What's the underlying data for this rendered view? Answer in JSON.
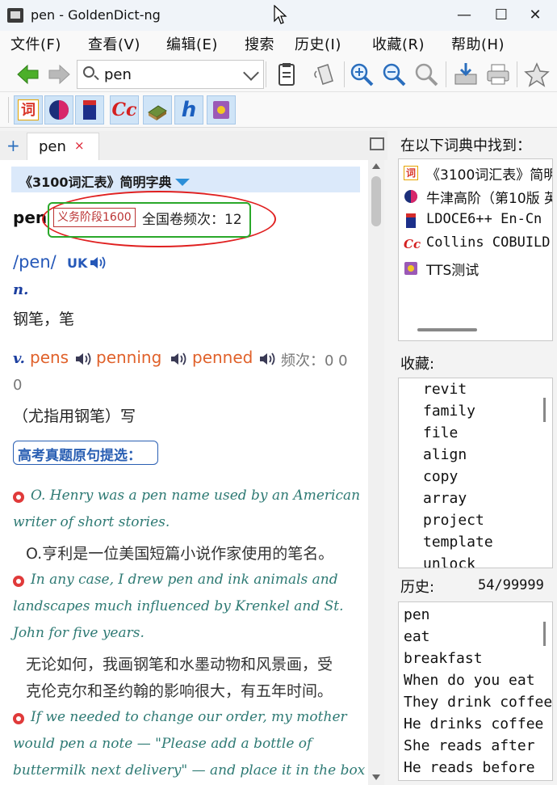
{
  "window": {
    "title": "pen - GoldenDict-ng",
    "minimize": "—",
    "maximize": "☐",
    "close": "✕"
  },
  "menu": [
    "文件(F)",
    "查看(V)",
    "编辑(E)",
    "搜索",
    "历史(I)",
    "收藏(R)",
    "帮助(H)"
  ],
  "search": {
    "value": "pen"
  },
  "dictionaries_bar": [
    {
      "icon": "ci-3100-icon",
      "glyph": "词"
    },
    {
      "icon": "oxford-icon",
      "glyph": ""
    },
    {
      "icon": "ldoce-icon",
      "glyph": ""
    },
    {
      "icon": "collins-icon",
      "glyph": "Cc"
    },
    {
      "icon": "book-icon",
      "glyph": ""
    },
    {
      "icon": "h-icon",
      "glyph": "h"
    },
    {
      "icon": "tts-icon",
      "glyph": ""
    }
  ],
  "tab": {
    "label": "pen",
    "close": "×",
    "add": "+"
  },
  "article": {
    "dict_name": "《3100词汇表》简明字典",
    "headword": "pen",
    "level_tag": "义务阶段1600",
    "freq_label": "全国卷频次：12",
    "phonetic": "/pen/",
    "uk": "UK",
    "pos1": "n.",
    "def1": "钢笔，笔",
    "pos2": "v.",
    "inflections": [
      "pens",
      "penning",
      "penned"
    ],
    "freq2": "频次：0 0",
    "freq2_cont": "0",
    "def2": "（尤指用钢笔）写",
    "exam_title": "高考真题原句提选：",
    "examples": [
      {
        "en": [
          "O. Henry was a pen name used by an American",
          "writer of short stories."
        ],
        "zh": [
          "O.亨利是一位美国短篇小说作家使用的笔名。"
        ]
      },
      {
        "en": [
          "In any case, I drew pen and ink animals and",
          "landscapes much influenced by Krenkel and St.",
          "John for five years."
        ],
        "zh": [
          "无论如何，我画钢笔和水墨动物和风景画，受",
          "克伦克尔和圣约翰的影响很大，有五年时间。"
        ]
      },
      {
        "en": [
          "If we needed to change our order, my mother",
          "would pen a note — \"Please add a bottle of",
          "buttermilk next delivery\" — and place it in the box"
        ],
        "zh": []
      }
    ]
  },
  "found_in": {
    "label": "在以下词典中找到：",
    "items": [
      {
        "icon": "ci-3100-icon",
        "text": "《3100词汇表》简明字典"
      },
      {
        "icon": "oxford-icon",
        "text": "牛津高阶（第10版 英汉双解）"
      },
      {
        "icon": "ldoce-icon",
        "text": "LDOCE6++ En-Cn"
      },
      {
        "icon": "collins-icon",
        "text": "Collins COBUILD"
      },
      {
        "icon": "tts-icon",
        "text": "TTS测试"
      }
    ]
  },
  "favorites": {
    "label": "收藏:",
    "items": [
      "revit",
      "family",
      "file",
      "align",
      "copy",
      "array",
      "project",
      "template",
      "unlock"
    ]
  },
  "history": {
    "label": "历史:",
    "count": "54/99999",
    "items": [
      "pen",
      "eat",
      "breakfast",
      "When do you eat",
      "They drink coffee",
      "He drinks coffee",
      "She reads after",
      "He reads before"
    ]
  },
  "colors": {
    "accent": "#2558b8",
    "inflection": "#e0612a",
    "example_en": "#2e7a74",
    "annotation_red": "#e02020",
    "annotation_green": "#2aa82a"
  }
}
